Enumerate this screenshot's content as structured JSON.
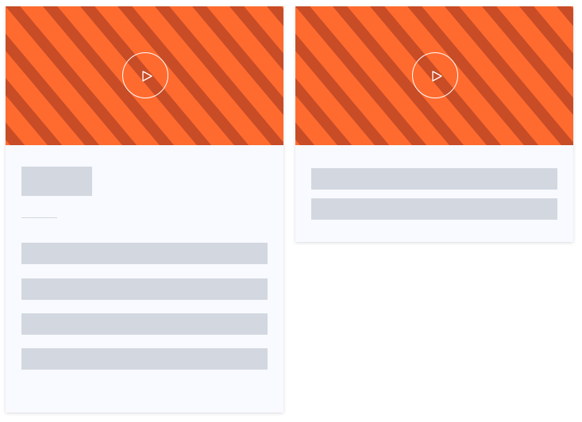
{
  "colors": {
    "stripe_light": "#ff6b2f",
    "stripe_dark": "#c84c26",
    "card_background": "#f8faff",
    "placeholder": "#d3d8e0",
    "play_icon": "#ffffff"
  },
  "cards": [
    {
      "media": {
        "icon": "play-icon"
      },
      "skeleton": {
        "title_block": true,
        "divider": true,
        "text_lines": 4
      }
    },
    {
      "media": {
        "icon": "play-icon"
      },
      "skeleton": {
        "title_block": false,
        "divider": false,
        "text_lines": 2
      }
    }
  ]
}
